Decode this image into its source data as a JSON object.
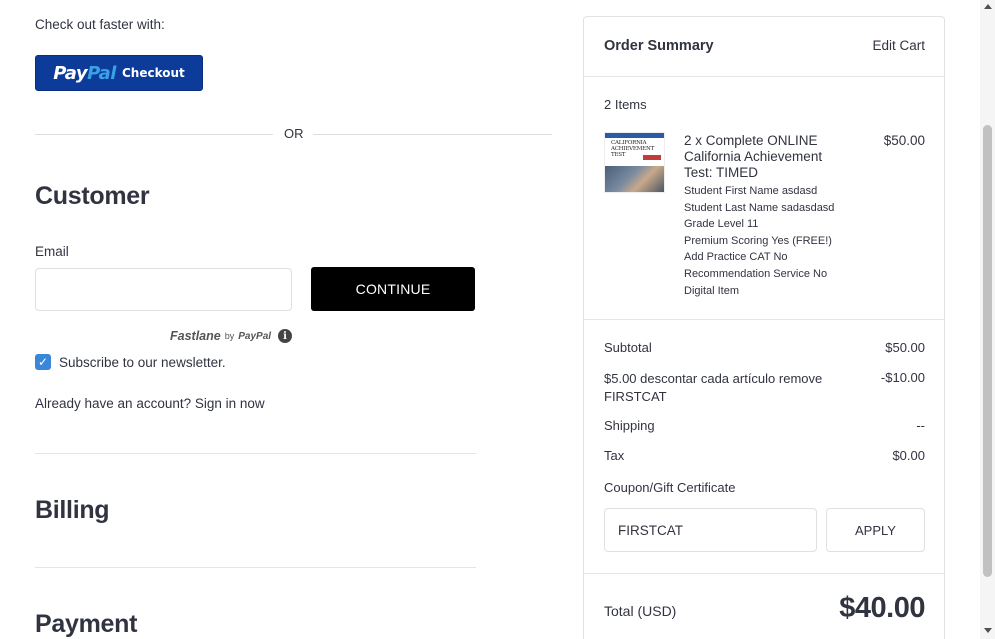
{
  "checkout": {
    "faster_label": "Check out faster with:",
    "paypal": {
      "brand_part1": "Pay",
      "brand_part2": "Pal",
      "action": "Checkout"
    },
    "or_label": "OR"
  },
  "customer": {
    "heading": "Customer",
    "email_label": "Email",
    "email_value": "",
    "continue_label": "CONTINUE",
    "fastlane": {
      "name": "Fastlane",
      "by": "by",
      "provider": "PayPal",
      "info_glyph": "i"
    },
    "newsletter_label": "Subscribe to our newsletter.",
    "newsletter_checked": true,
    "account_prompt": "Already have an account?",
    "sign_in_label": "Sign in now"
  },
  "billing": {
    "heading": "Billing"
  },
  "payment": {
    "heading": "Payment"
  },
  "summary": {
    "title": "Order Summary",
    "edit_cart_label": "Edit Cart",
    "items_count": "2 Items",
    "product": {
      "name": "2 x Complete ONLINE California Achievement Test: TIMED",
      "price": "$50.00",
      "thumb_text": [
        "CALIFORNIA",
        "ACHIEVEMENT",
        "TEST"
      ],
      "options": [
        "Student First Name asdasd",
        "Student Last Name sadasdasd",
        "Grade Level 11",
        "Premium Scoring Yes (FREE!)",
        "Add Practice CAT No",
        "Recommendation Service No",
        "Digital Item"
      ]
    },
    "subtotal_label": "Subtotal",
    "subtotal_value": "$50.00",
    "discount_text": "$5.00 descontar cada artículo",
    "discount_remove_label": "remove",
    "discount_code": "FIRSTCAT",
    "discount_value": "-$10.00",
    "shipping_label": "Shipping",
    "shipping_value": "--",
    "tax_label": "Tax",
    "tax_value": "$0.00",
    "coupon_label": "Coupon/Gift Certificate",
    "coupon_value": "FIRSTCAT",
    "apply_label": "APPLY",
    "total_label": "Total (USD)",
    "total_value": "$40.00"
  },
  "colors": {
    "paypal_blue": "#0c3b9a",
    "paypal_light": "#3aa1e6",
    "checkbox_blue": "#3a87d9",
    "continue_bg": "#000000",
    "text": "#313440"
  }
}
